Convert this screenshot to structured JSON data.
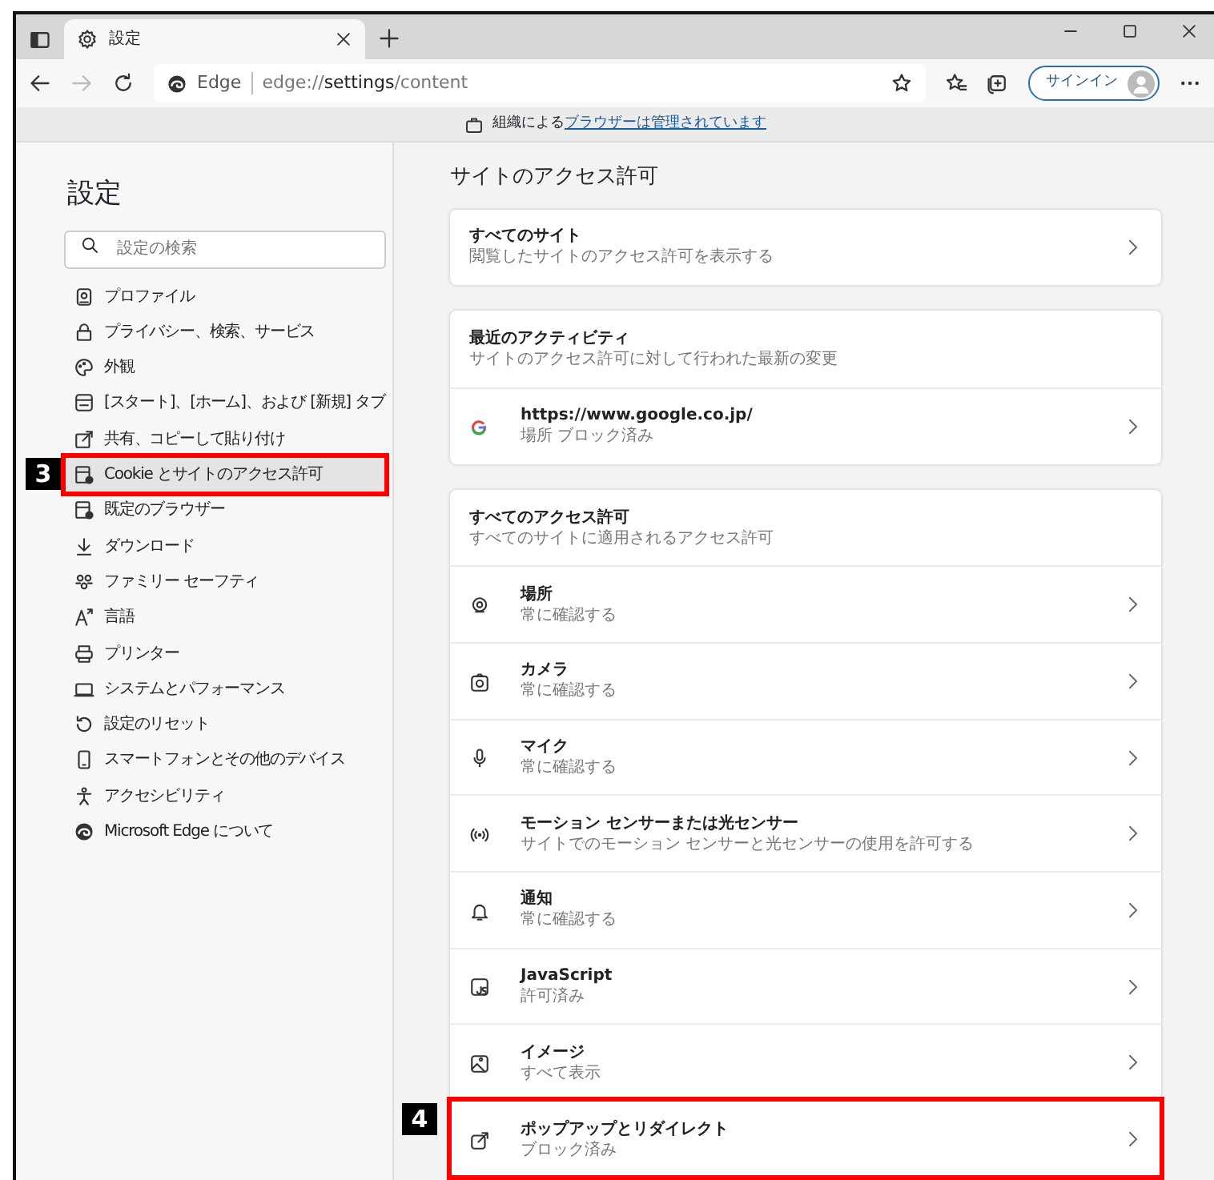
{
  "browser": {
    "tab": {
      "title": "設定"
    },
    "address": {
      "brand": "Edge",
      "url_prefix": "edge://",
      "url_bold": "settings",
      "url_suffix": "/content"
    },
    "signin": "サインイン"
  },
  "info_bar": {
    "text": "組織による",
    "link": "ブラウザーは管理されています"
  },
  "sidebar": {
    "title": "設定",
    "search": {
      "placeholder": "設定の検索"
    },
    "items": [
      {
        "label": "プロファイル",
        "selected": false
      },
      {
        "label": "プライバシー、検索、サービス",
        "selected": false
      },
      {
        "label": "外観",
        "selected": false
      },
      {
        "label": "[スタート]、[ホーム]、および [新規] タブ",
        "selected": false
      },
      {
        "label": "共有、コピーして貼り付け",
        "selected": false
      },
      {
        "label": "Cookie とサイトのアクセス許可",
        "selected": true,
        "callout": "3"
      },
      {
        "label": "既定のブラウザー",
        "selected": false
      },
      {
        "label": "ダウンロード",
        "selected": false
      },
      {
        "label": "ファミリー セーフティ",
        "selected": false
      },
      {
        "label": "言語",
        "selected": false
      },
      {
        "label": "プリンター",
        "selected": false
      },
      {
        "label": "システムとパフォーマンス",
        "selected": false
      },
      {
        "label": "設定のリセット",
        "selected": false
      },
      {
        "label": "スマートフォンとその他のデバイス",
        "selected": false
      },
      {
        "label": "アクセシビリティ",
        "selected": false
      },
      {
        "label": "Microsoft Edge について",
        "selected": false
      }
    ]
  },
  "main": {
    "heading": "サイトのアクセス許可",
    "cards": [
      {
        "rows": [
          {
            "kind": "link",
            "title": "すべてのサイト",
            "subtitle": "閲覧したサイトのアクセス許可を表示する"
          }
        ]
      },
      {
        "rows": [
          {
            "kind": "header",
            "title": "最近のアクティビティ",
            "subtitle": "サイトのアクセス許可に対して行われた最新の変更"
          },
          {
            "kind": "site",
            "title": "https://www.google.co.jp/",
            "subtitle": "場所 ブロック済み"
          }
        ]
      },
      {
        "rows": [
          {
            "kind": "header",
            "title": "すべてのアクセス許可",
            "subtitle": "すべてのサイトに適用されるアクセス許可"
          },
          {
            "kind": "setting",
            "title": "場所",
            "subtitle": "常に確認する"
          },
          {
            "kind": "setting",
            "title": "カメラ",
            "subtitle": "常に確認する"
          },
          {
            "kind": "setting",
            "title": "マイク",
            "subtitle": "常に確認する"
          },
          {
            "kind": "setting",
            "title": "モーション センサーまたは光センサー",
            "subtitle": "サイトでのモーション センサーと光センサーの使用を許可する"
          },
          {
            "kind": "setting",
            "title": "通知",
            "subtitle": "常に確認する"
          },
          {
            "kind": "setting",
            "title": "JavaScript",
            "subtitle": "許可済み"
          },
          {
            "kind": "setting",
            "title": "イメージ",
            "subtitle": "すべて表示"
          },
          {
            "kind": "setting",
            "title": "ポップアップとリダイレクト",
            "subtitle": "ブロック済み",
            "callout": "4"
          }
        ]
      }
    ]
  }
}
